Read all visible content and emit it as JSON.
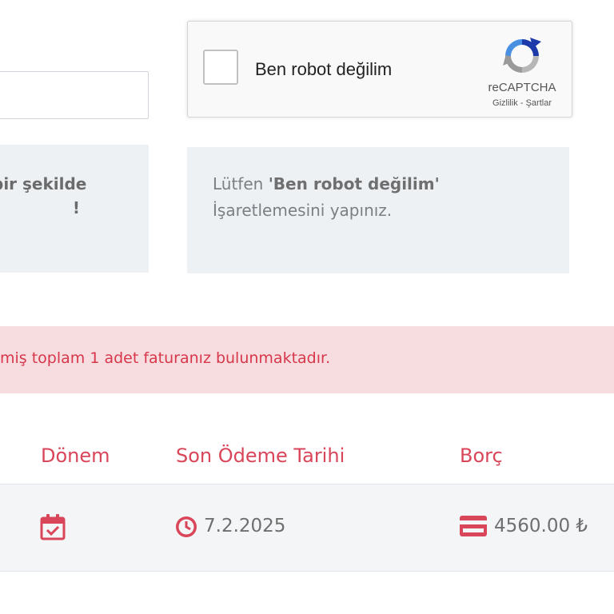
{
  "captcha": {
    "label": "Ben robot değilim",
    "brand": "reCAPTCHA",
    "privacy_link": "Gizlilik",
    "separator": " - ",
    "terms_link": "Şartlar"
  },
  "left_input": {
    "value": ""
  },
  "left_notice": {
    "line1": "bir şekilde",
    "line2": "!"
  },
  "right_notice": {
    "prefix": "Lütfen ",
    "bold": "'Ben robot değilim'",
    "suffix": " İşaretlemesini yapınız."
  },
  "alert": {
    "text": "miş toplam 1 adet faturanız bulunmaktadır.",
    "color": "#d6374a"
  },
  "table": {
    "headers": [
      "Dönem",
      "Son Ödeme Tarihi",
      "Borç"
    ],
    "rows": [
      {
        "period_icon": "calendar-check-icon",
        "due_date": "7.2.2025",
        "debt": "4560.00 ₺"
      }
    ]
  },
  "colors": {
    "accent": "#d94559",
    "notice_bg": "#eef1f4",
    "alert_bg": "#f8dde0"
  }
}
